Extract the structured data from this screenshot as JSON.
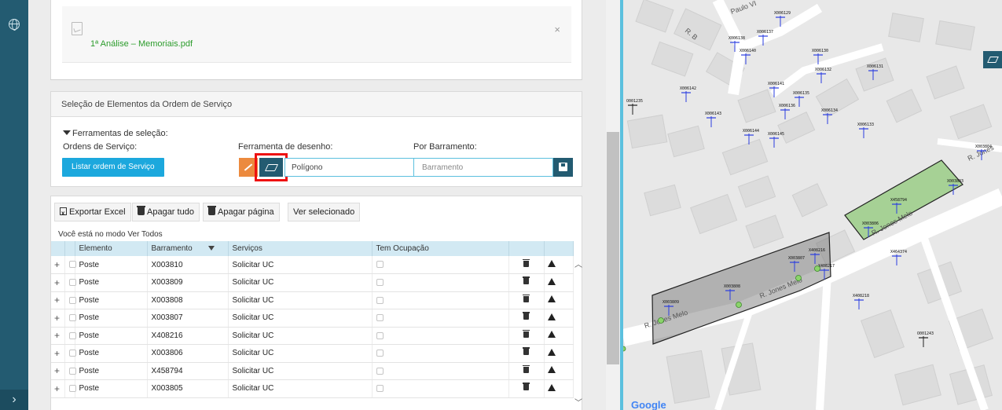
{
  "attachment": {
    "file_name": "1ª Análise – Memoriais.pdf",
    "remove": "×"
  },
  "selection": {
    "header": "Seleção de Elementos da Ordem de Serviço",
    "tools_title": "Ferramentas de seleção:",
    "ordens_label": "Ordens de Serviço:",
    "ferramenta_label": "Ferramenta de desenho:",
    "barramento_label": "Por Barramento:",
    "listar_button": "Listar ordem de Serviço",
    "draw_tool_value": "Polígono",
    "barramento_placeholder": "Barramento"
  },
  "toolbar": {
    "export": "Exportar Excel",
    "delete_all": "Apagar tudo",
    "delete_page": "Apagar página",
    "view_selected": "Ver selecionado",
    "mode_text": "Você está no modo Ver Todos"
  },
  "table": {
    "columns": [
      "Elemento",
      "Barramento",
      "Serviços",
      "Tem Ocupação"
    ],
    "rows": [
      {
        "elemento": "Poste",
        "barramento": "X003810",
        "servicos": "Solicitar UC"
      },
      {
        "elemento": "Poste",
        "barramento": "X003809",
        "servicos": "Solicitar UC"
      },
      {
        "elemento": "Poste",
        "barramento": "X003808",
        "servicos": "Solicitar UC"
      },
      {
        "elemento": "Poste",
        "barramento": "X003807",
        "servicos": "Solicitar UC"
      },
      {
        "elemento": "Poste",
        "barramento": "X408216",
        "servicos": "Solicitar UC"
      },
      {
        "elemento": "Poste",
        "barramento": "X003806",
        "servicos": "Solicitar UC"
      },
      {
        "elemento": "Poste",
        "barramento": "X458794",
        "servicos": "Solicitar UC"
      },
      {
        "elemento": "Poste",
        "barramento": "X003805",
        "servicos": "Solicitar UC"
      }
    ]
  },
  "map": {
    "streets": [
      "R. Jones Melo",
      "R. Jones Melo",
      "R. Jones Melo",
      "R. Jones",
      "R. B",
      "Paulo VI"
    ],
    "pole_labels": [
      "X006129",
      "X006138",
      "X006137",
      "X006140",
      "X006130",
      "X006131",
      "X006132",
      "X006142",
      "X006141",
      "X006135",
      "X006136",
      "X006134",
      "O001235",
      "X006143",
      "X006144",
      "X006145",
      "X006133",
      "X003804",
      "X003803",
      "X458794",
      "X003806",
      "X408216",
      "X464374",
      "X003807",
      "X408217",
      "X003808",
      "X003809",
      "X408218",
      "O001243"
    ],
    "google": "Google",
    "polygon_color": "#90c97a"
  }
}
